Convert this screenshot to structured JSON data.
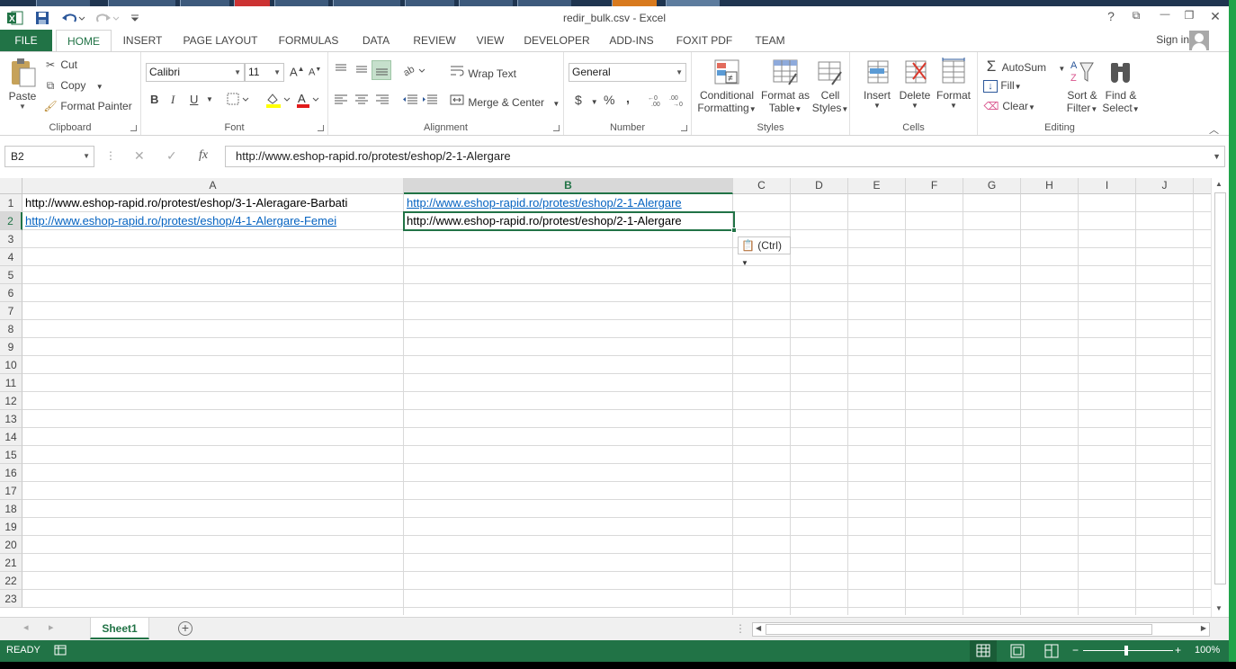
{
  "window": {
    "title": "redir_bulk.csv - Excel",
    "help": "?",
    "restore_ribbon": "⧉",
    "minimize": "—",
    "maximize": "❐",
    "close": "✕"
  },
  "quick_access": {
    "app_icon": "excel-icon",
    "save_icon": "save-icon",
    "undo_icon": "undo-icon",
    "redo_icon": "redo-icon"
  },
  "tabs": [
    "FILE",
    "HOME",
    "INSERT",
    "PAGE LAYOUT",
    "FORMULAS",
    "DATA",
    "REVIEW",
    "VIEW",
    "DEVELOPER",
    "ADD-INS",
    "FOXIT PDF",
    "TEAM"
  ],
  "active_tab": "HOME",
  "signin": "Sign in",
  "ribbon": {
    "clipboard": {
      "label": "Clipboard",
      "paste": "Paste",
      "cut": "Cut",
      "copy": "Copy",
      "format_painter": "Format Painter"
    },
    "font": {
      "label": "Font",
      "name": "Calibri",
      "size": "11",
      "bold": "B",
      "italic": "I",
      "underline": "U"
    },
    "alignment": {
      "label": "Alignment",
      "wrap": "Wrap Text",
      "merge": "Merge & Center"
    },
    "number": {
      "label": "Number",
      "format": "General",
      "currency": "$",
      "percent": "%",
      "comma": ","
    },
    "styles": {
      "label": "Styles",
      "conditional_1": "Conditional",
      "conditional_2": "Formatting",
      "table_1": "Format as",
      "table_2": "Table",
      "cell_1": "Cell",
      "cell_2": "Styles"
    },
    "cells": {
      "label": "Cells",
      "insert": "Insert",
      "delete": "Delete",
      "format": "Format"
    },
    "editing": {
      "label": "Editing",
      "autosum": "AutoSum",
      "fill": "Fill",
      "clear": "Clear",
      "sort_1": "Sort &",
      "sort_2": "Filter",
      "find_1": "Find &",
      "find_2": "Select"
    }
  },
  "formula_bar": {
    "name_box": "B2",
    "cancel": "✕",
    "enter": "✓",
    "fx": "fx",
    "content": "http://www.eshop-rapid.ro/protest/eshop/2-1-Alergare"
  },
  "columns": [
    "A",
    "B",
    "C",
    "D",
    "E",
    "F",
    "G",
    "H",
    "I",
    "J"
  ],
  "rows": [
    "1",
    "2",
    "3",
    "4",
    "5",
    "6",
    "7",
    "8",
    "9",
    "10",
    "11",
    "12",
    "13",
    "14",
    "15",
    "16",
    "17",
    "18",
    "19",
    "20",
    "21",
    "22",
    "23"
  ],
  "cells": {
    "A1": "http://www.eshop-rapid.ro/protest/eshop/3-1-Aleragare-Barbati",
    "B1": "http://www.eshop-rapid.ro/protest/eshop/2-1-Alergare",
    "A2": "http://www.eshop-rapid.ro/protest/eshop/4-1-Alergare-Femei",
    "B2": "http://www.eshop-rapid.ro/protest/eshop/2-1-Alergare"
  },
  "paste_options": "(Ctrl)",
  "sheet": {
    "name": "Sheet1",
    "add": "+"
  },
  "status": {
    "ready": "READY",
    "zoom": "100%"
  },
  "colors": {
    "accent": "#217346",
    "link": "#0563c1"
  }
}
